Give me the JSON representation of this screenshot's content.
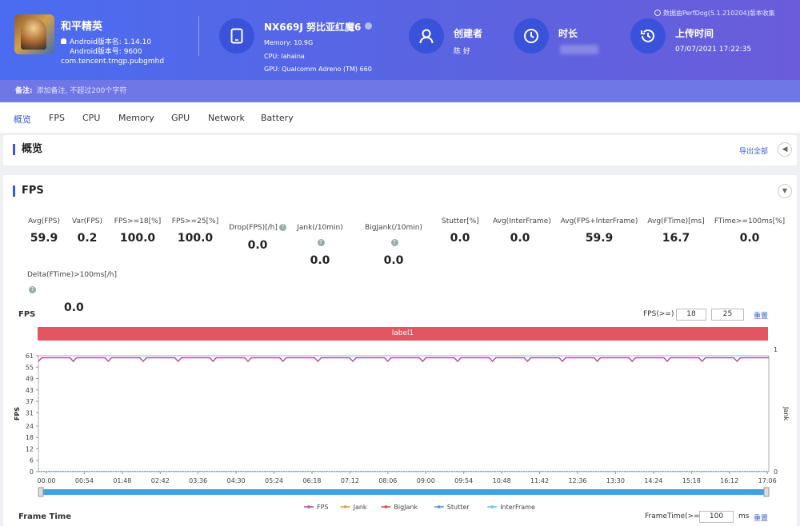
{
  "header": {
    "app_name": "和平精英",
    "android_version_name": "Android版本名: 1.14.10",
    "android_version_code": "Android版本号: 9600",
    "package": "com.tencent.tmgp.pubgmhd",
    "device_name": "NX669J 努比亚红魔6",
    "memory": "Memory: 10.9G",
    "cpu": "CPU: lahaina",
    "gpu": "GPU: Qualcomm Adreno (TM) 660",
    "creator_label": "创建者",
    "creator_value": "陈 好",
    "duration_label": "时长",
    "upload_label": "上传时间",
    "upload_value": "07/07/2021 17:22:35",
    "perfdog_note": "数据由PerfDog(5.1.210204)版本收集",
    "remark_label": "备注:",
    "remark_placeholder": "添加备注, 不超过200个字符"
  },
  "tabs": [
    "概览",
    "FPS",
    "CPU",
    "Memory",
    "GPU",
    "Network",
    "Battery"
  ],
  "overview": {
    "title": "概览",
    "export_all": "导出全部"
  },
  "fps_panel": {
    "title": "FPS",
    "stats": [
      {
        "label": "Avg(FPS)",
        "value": "59.9"
      },
      {
        "label": "Var(FPS)",
        "value": "0.2"
      },
      {
        "label": "FPS>=18[%]",
        "value": "100.0"
      },
      {
        "label": "FPS>=25[%]",
        "value": "100.0"
      },
      {
        "label": "Drop(FPS)[/h]",
        "value": "0.0"
      },
      {
        "label": "Jank(/10min)",
        "value": "0.0"
      },
      {
        "label": "BigJank(/10min)",
        "value": "0.0"
      },
      {
        "label": "Stutter[%]",
        "value": "0.0"
      },
      {
        "label": "Avg(InterFrame)",
        "value": "0.0"
      },
      {
        "label": "Avg(FPS+InterFrame)",
        "value": "59.9"
      },
      {
        "label": "Avg(FTime)[ms]",
        "value": "16.7"
      },
      {
        "label": "FTime>=100ms[%]",
        "value": "0.0"
      },
      {
        "label": "Delta(FTime)>100ms[/h]",
        "value": "0.0"
      }
    ],
    "chart_title": "FPS",
    "threshold_label": "FPS(>=)",
    "threshold_1": "18",
    "threshold_2": "25",
    "reset_label": "重置",
    "label_bar": "label1",
    "ylabel_left": "FPS",
    "ylabel_right": "Jank",
    "frametime_title": "Frame Time",
    "frametime_label": "FrameTime(>=)",
    "frametime_value": "100",
    "frametime_unit": "ms",
    "frametime_reset": "重置"
  },
  "chart_data": {
    "type": "line",
    "y_ticks": [
      0,
      6,
      12,
      18,
      24,
      31,
      37,
      43,
      49,
      55,
      61
    ],
    "ylim": [
      0,
      61
    ],
    "y2_ticks": [
      0,
      1
    ],
    "y2lim": [
      0,
      1
    ],
    "x_ticks": [
      "00:00",
      "00:54",
      "01:48",
      "02:42",
      "03:36",
      "04:30",
      "05:24",
      "06:18",
      "07:12",
      "08:06",
      "09:00",
      "09:54",
      "10:48",
      "11:42",
      "12:36",
      "13:30",
      "14:24",
      "15:18",
      "16:12",
      "17:06"
    ],
    "series": [
      {
        "name": "FPS",
        "color": "#c03fa8",
        "mean": 59.9,
        "min_dip": 58
      },
      {
        "name": "Jank",
        "color": "#f0932b",
        "value": 0
      },
      {
        "name": "BigJank",
        "color": "#e0453a",
        "value": 0
      },
      {
        "name": "Stutter",
        "color": "#4a90e2",
        "value": 0
      },
      {
        "name": "InterFrame",
        "color": "#58c7e8",
        "value": 0
      }
    ]
  }
}
